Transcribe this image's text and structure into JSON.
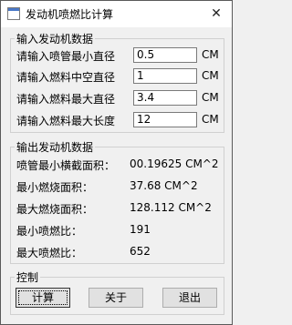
{
  "window": {
    "title": "发动机喷燃比计算",
    "close_symbol": "✕"
  },
  "input_group": {
    "legend": "输入发动机数据",
    "fields": [
      {
        "label": "请输入喷管最小直径",
        "value": "0.5",
        "unit": "CM"
      },
      {
        "label": "请输入燃料中空直径",
        "value": "1",
        "unit": "CM"
      },
      {
        "label": "请输入燃料最大直径",
        "value": "3.4",
        "unit": "CM"
      },
      {
        "label": "请输入燃料最大长度",
        "value": "12",
        "unit": "CM"
      }
    ]
  },
  "output_group": {
    "legend": "输出发动机数据",
    "rows": [
      {
        "label": "喷管最小横截面积：",
        "value": "00.19625 CM^2"
      },
      {
        "label": "最小燃烧面积：",
        "value": "37.68    CM^2"
      },
      {
        "label": "最大燃烧面积：",
        "value": "128.112  CM^2"
      },
      {
        "label": "最小喷燃比：",
        "value": "191"
      },
      {
        "label": "最大喷燃比：",
        "value": "652"
      }
    ]
  },
  "control_group": {
    "legend": "控制",
    "buttons": {
      "calc": "计算",
      "about": "关于",
      "exit": "退出"
    }
  }
}
